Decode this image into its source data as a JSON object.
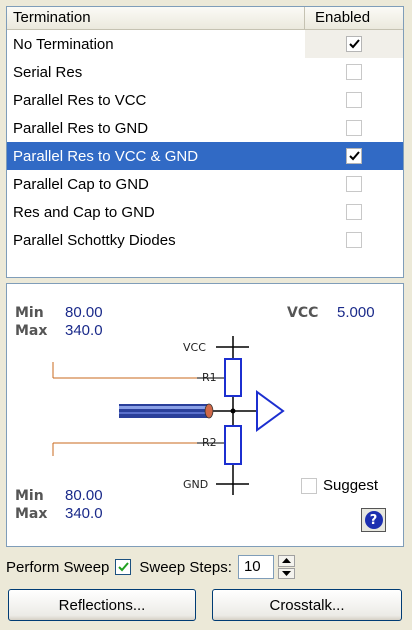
{
  "table": {
    "header": {
      "col1": "Termination",
      "col2": "Enabled"
    },
    "rows": [
      {
        "label": "No Termination",
        "enabled": true
      },
      {
        "label": "Serial Res",
        "enabled": false
      },
      {
        "label": "Parallel Res to VCC",
        "enabled": false
      },
      {
        "label": "Parallel Res to GND",
        "enabled": false
      },
      {
        "label": "Parallel Res to VCC & GND",
        "enabled": true,
        "selected": true
      },
      {
        "label": "Parallel Cap to GND",
        "enabled": false
      },
      {
        "label": "Res and Cap to GND",
        "enabled": false
      },
      {
        "label": "Parallel Schottky Diodes",
        "enabled": false
      }
    ]
  },
  "diagram": {
    "top": {
      "min_label": "Min",
      "min_value": "80.00",
      "max_label": "Max",
      "max_value": "340.0"
    },
    "bottom": {
      "min_label": "Min",
      "min_value": "80.00",
      "max_label": "Max",
      "max_value": "340.0"
    },
    "vcc_label": "VCC",
    "vcc_value": "5.000",
    "node_vcc": "VCC",
    "node_gnd": "GND",
    "r1": "R1",
    "r2": "R2",
    "suggest_label": "Suggest",
    "suggest_checked": false,
    "help_icon": "question-mark-icon",
    "help_glyph": "?"
  },
  "sweep": {
    "label": "Perform Sweep",
    "checked": true,
    "steps_label": "Sweep Steps:",
    "steps_value": "10"
  },
  "buttons": {
    "reflections": "Reflections...",
    "crosstalk": "Crosstalk..."
  },
  "colors": {
    "selection": "#316ac5",
    "value_text": "#1a2a8a",
    "wire": "#c8691e",
    "component": "#1c2fd0"
  }
}
